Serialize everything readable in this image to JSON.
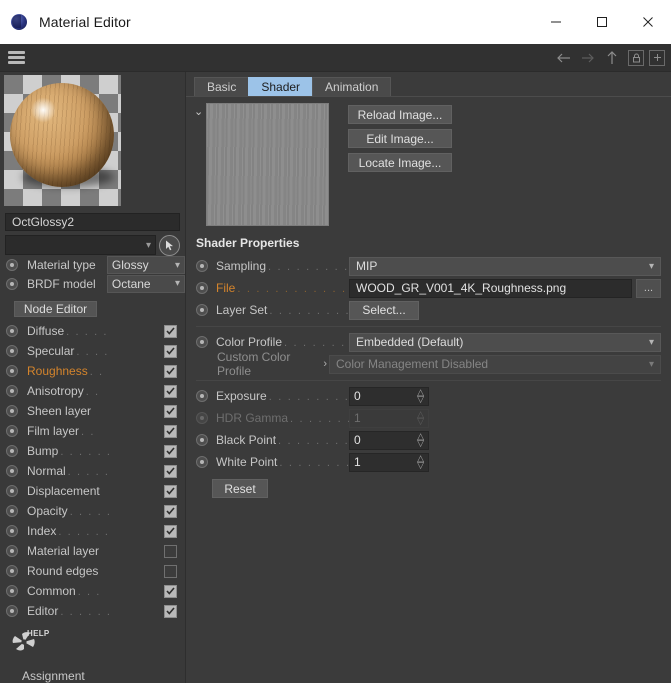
{
  "window": {
    "title": "Material Editor",
    "app_icon": "octane-sphere-icon",
    "controls": {
      "minimize": "minimize-icon",
      "maximize": "maximize-icon",
      "close": "close-icon"
    }
  },
  "toolbar": {
    "menu_icon": "hamburger-menu-icon",
    "icons": [
      {
        "name": "back-icon",
        "glyph": "←"
      },
      {
        "name": "forward-icon",
        "glyph": "→"
      },
      {
        "name": "up-icon",
        "glyph": "↑"
      },
      {
        "name": "lock-icon",
        "glyph": "lock"
      },
      {
        "name": "add-panel-icon",
        "glyph": "+"
      }
    ]
  },
  "left_panel": {
    "preview_name": "material-preview-sphere",
    "material_name": "OctGlossy2",
    "search_placeholder": "",
    "search_value": "",
    "picker_icon": "cursor-picker-icon",
    "settings": [
      {
        "label": "Material type",
        "value": "Glossy"
      },
      {
        "label": "BRDF model",
        "value": "Octane"
      }
    ],
    "node_editor_label": "Node Editor",
    "channels": [
      {
        "label": "Diffuse",
        "dots": ". . . . .",
        "checked": true,
        "highlight": false
      },
      {
        "label": "Specular",
        "dots": ". . . .",
        "checked": true,
        "highlight": false
      },
      {
        "label": "Roughness",
        "dots": ". .",
        "checked": true,
        "highlight": true
      },
      {
        "label": "Anisotropy",
        "dots": ". .",
        "checked": true,
        "highlight": false
      },
      {
        "label": "Sheen layer",
        "dots": "",
        "checked": true,
        "highlight": false
      },
      {
        "label": "Film layer",
        "dots": ". .",
        "checked": true,
        "highlight": false
      },
      {
        "label": "Bump",
        "dots": ". . . . . .",
        "checked": true,
        "highlight": false
      },
      {
        "label": "Normal",
        "dots": ". . . . .",
        "checked": true,
        "highlight": false
      },
      {
        "label": "Displacement",
        "dots": "",
        "checked": true,
        "highlight": false
      },
      {
        "label": "Opacity",
        "dots": ". . . . .",
        "checked": true,
        "highlight": false
      },
      {
        "label": "Index",
        "dots": ". . . . . .",
        "checked": true,
        "highlight": false
      },
      {
        "label": "Material layer",
        "dots": "",
        "checked": false,
        "highlight": false
      },
      {
        "label": "Round edges",
        "dots": "",
        "checked": false,
        "highlight": false
      },
      {
        "label": "Common",
        "dots": ". . .",
        "checked": true,
        "highlight": false
      },
      {
        "label": "Editor",
        "dots": ". . . . . .",
        "checked": true,
        "highlight": false
      }
    ],
    "help_icon": "octane-help-icon",
    "help_label": "HELP",
    "assignment_label": "Assignment"
  },
  "right_panel": {
    "tabs": [
      {
        "label": "Basic",
        "active": false
      },
      {
        "label": "Shader",
        "active": true
      },
      {
        "label": "Animation",
        "active": false
      }
    ],
    "thumbnail_name": "texture-thumbnail",
    "thumbnail_caret": "⌄",
    "image_buttons": [
      {
        "label": "Reload Image..."
      },
      {
        "label": "Edit Image..."
      },
      {
        "label": "Locate Image..."
      }
    ],
    "section_title": "Shader Properties",
    "sampling": {
      "label": "Sampling",
      "dots": ". . . . . . . . .",
      "value": "MIP"
    },
    "file": {
      "label": "File",
      "dots": ". . . . . . . . . . . . .",
      "value": "WOOD_GR_V001_4K_Roughness.png",
      "browse_label": "..."
    },
    "layer_set": {
      "label": "Layer Set",
      "dots": ". . . . . . . . .",
      "button_label": "Select..."
    },
    "color_profile": {
      "label": "Color Profile",
      "dots": ". . . . . . .",
      "value": "Embedded (Default)"
    },
    "custom_color_profile": {
      "label": "Custom Color Profile",
      "arrow": "›",
      "value": "Color Management Disabled"
    },
    "exposure": {
      "label": "Exposure",
      "dots": ". . . . . . . . . .",
      "value": "0",
      "enabled": true
    },
    "hdr_gamma": {
      "label": "HDR Gamma",
      "dots": ". . . . . . . .",
      "value": "1",
      "enabled": false
    },
    "black_point": {
      "label": "Black Point",
      "dots": ". . . . . . . .",
      "value": "0",
      "enabled": true
    },
    "white_point": {
      "label": "White Point",
      "dots": ". . . . . . . .",
      "value": "1",
      "enabled": true
    },
    "reset_label": "Reset"
  },
  "colors": {
    "accent_tab": "#9cc3e8",
    "highlight_orange": "#d4842c",
    "panel_bg": "#393939",
    "right_bg": "#3b3b3b",
    "titlebar_bg": "#ffffff"
  }
}
